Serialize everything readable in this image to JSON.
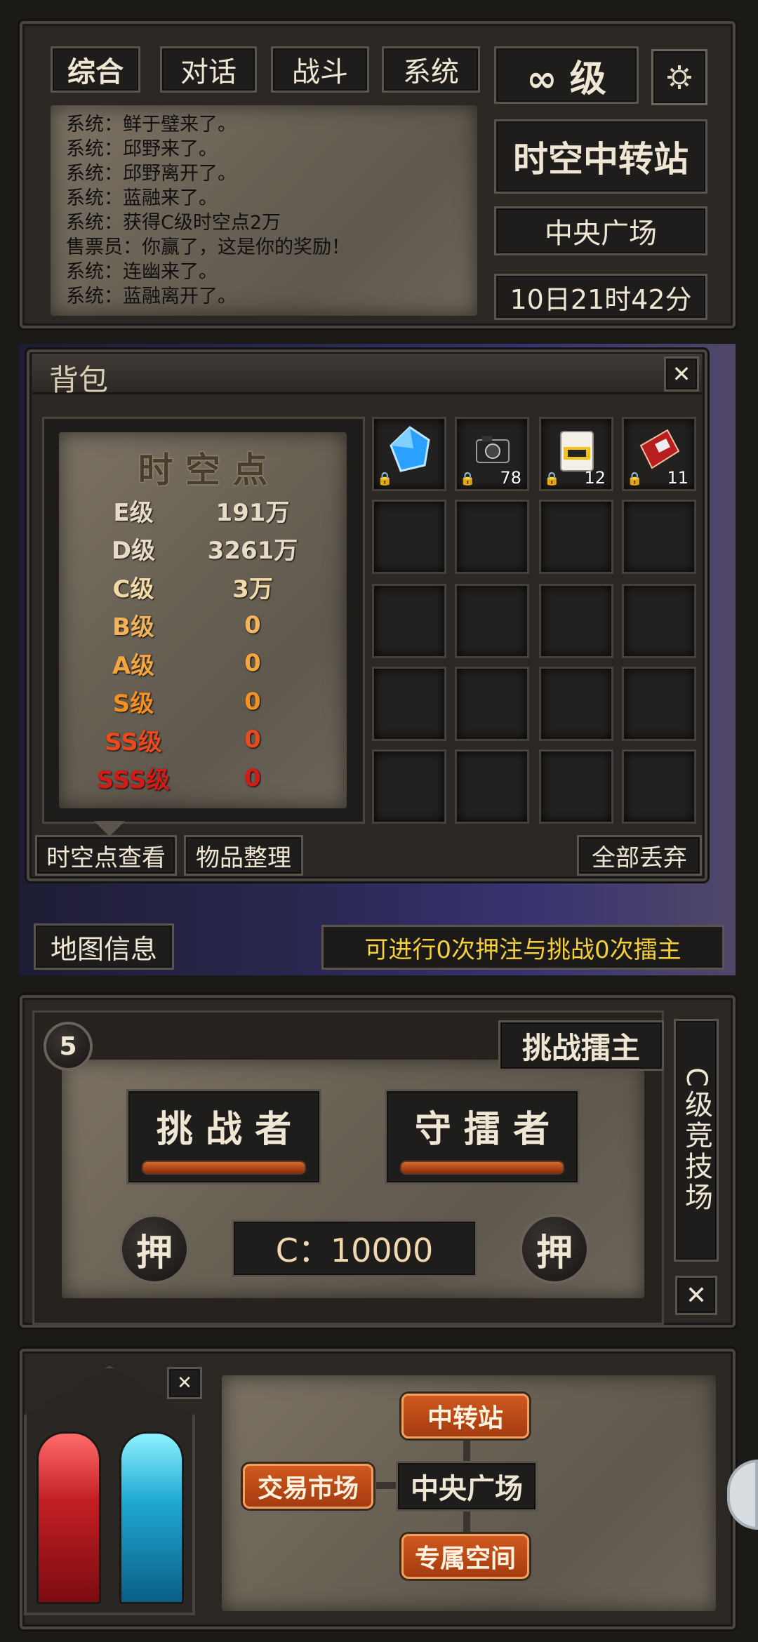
{
  "chat": {
    "tabs": [
      "综合",
      "对话",
      "战斗",
      "系统"
    ],
    "messages": [
      "系统：鲜于璧来了。",
      "系统：邱野来了。",
      "系统：邱野离开了。",
      "系统：蓝融来了。",
      "系统：获得C级时空点2万",
      "售票员：你赢了，这是你的奖励！",
      "系统：连幽来了。",
      "系统：蓝融离开了。"
    ]
  },
  "status": {
    "level": "∞ 级",
    "location_title": "时空中转站",
    "area": "中央广场",
    "time": "10日21时42分"
  },
  "bag": {
    "title": "背包",
    "points_title": "时 空 点",
    "points": [
      {
        "grade": "E级",
        "value": "191万",
        "color": "#e8dcc6"
      },
      {
        "grade": "D级",
        "value": "3261万",
        "color": "#e8dcc6"
      },
      {
        "grade": "C级",
        "value": "3万",
        "color": "#f3d9a6"
      },
      {
        "grade": "B级",
        "value": "0",
        "color": "#f4b25a"
      },
      {
        "grade": "A级",
        "value": "0",
        "color": "#f4a63e"
      },
      {
        "grade": "S级",
        "value": "0",
        "color": "#f29022"
      },
      {
        "grade": "SS级",
        "value": "0",
        "color": "#e84a1e"
      },
      {
        "grade": "SSS级",
        "value": "0",
        "color": "#d41a14"
      }
    ],
    "items": [
      {
        "icon": "blue-crystal-icon",
        "qty": ""
      },
      {
        "icon": "camera-icon",
        "qty": "78"
      },
      {
        "icon": "ration-bag-icon",
        "qty": "12"
      },
      {
        "icon": "red-book-icon",
        "qty": "11"
      }
    ],
    "buttons": {
      "view_points": "时空点查看",
      "sort": "物品整理",
      "discard_all": "全部丢弃"
    }
  },
  "map": {
    "info_button": "地图信息",
    "notice": "可进行0次押注与挑战0次擂主"
  },
  "arena": {
    "round_number": "5",
    "challenge_button": "挑战擂主",
    "challenger": "挑 战 者",
    "defender": "守 擂 者",
    "bet_label": "押",
    "bet_amount": "C：10000",
    "side_title": "C级竞技场"
  },
  "nav": {
    "transfer_station": "中转站",
    "trade_market": "交易市场",
    "central_plaza": "中央广场",
    "private_space": "专属空间"
  },
  "colors": {
    "accent_orange": "#c24b17",
    "notice_yellow": "#f4d03a"
  }
}
